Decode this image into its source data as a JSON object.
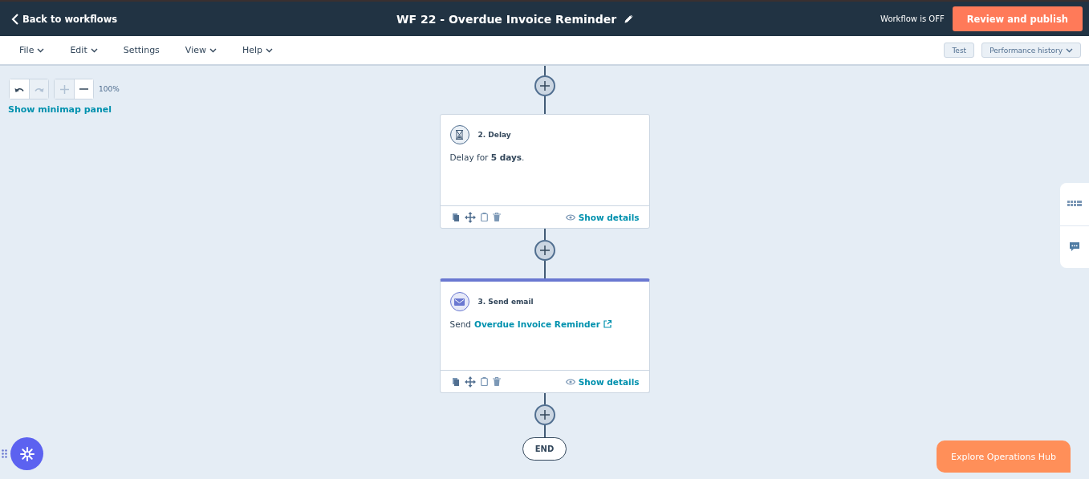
{
  "header": {
    "back_link": "Back to workflows",
    "title": "WF 22 - Overdue Invoice Reminder",
    "status": "Workflow is OFF",
    "publish_button": "Review and publish"
  },
  "menu": {
    "items": [
      {
        "label": "File",
        "dropdown": true
      },
      {
        "label": "Edit",
        "dropdown": true
      },
      {
        "label": "Settings",
        "dropdown": false
      },
      {
        "label": "View",
        "dropdown": true
      },
      {
        "label": "Help",
        "dropdown": true
      }
    ],
    "buttons": [
      {
        "label": "Test",
        "dropdown": false
      },
      {
        "label": "Performance history",
        "dropdown": true
      }
    ]
  },
  "canvas_controls": {
    "buttons": [
      {
        "kind": "undo",
        "disabled": false
      },
      {
        "kind": "redo",
        "disabled": true
      },
      {
        "kind": "zoom_in",
        "disabled": true
      },
      {
        "kind": "zoom_out",
        "disabled": false
      }
    ],
    "zoom": "100%",
    "minimap_link": "Show minimap panel"
  },
  "actions": [
    {
      "kind": "delay",
      "title": "2. Delay",
      "description": "Delay for **5 days**.",
      "selected": false,
      "details_link": "Show details"
    },
    {
      "kind": "email",
      "title": "3. Send email",
      "prefix": "Send",
      "email_link": "Overdue Invoice Reminder",
      "selected": true,
      "details_link": "Show details"
    }
  ],
  "end_label": "END",
  "explore_button": "Explore Operations Hub"
}
